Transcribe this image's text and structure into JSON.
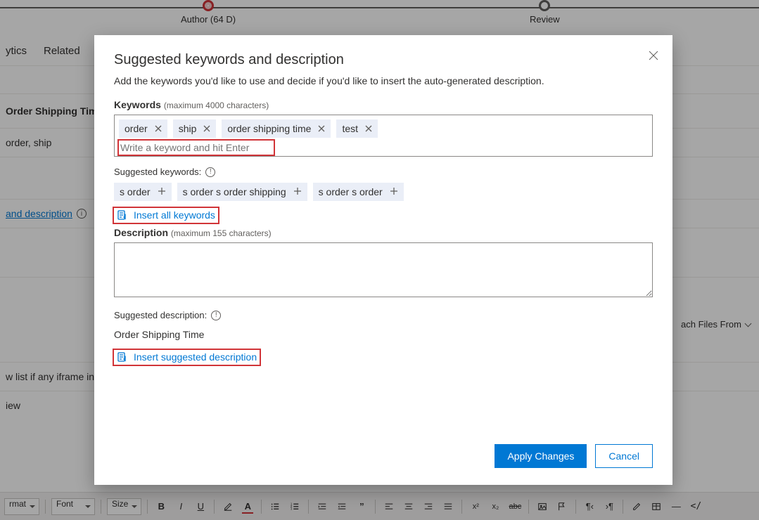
{
  "stepper": {
    "author": "Author  (64 D)",
    "review": "Review"
  },
  "tabs": {
    "analytics": "ytics",
    "related": "Related"
  },
  "bg": {
    "row1": "Order Shipping Time",
    "row2": "order, ship",
    "link": "and description",
    "iframe": "w list if any iframe in t",
    "view": "iew",
    "attach": "ach Files From"
  },
  "toolbar": {
    "format": "rmat",
    "font": "Font",
    "size": "Size"
  },
  "dialog": {
    "title": "Suggested keywords and description",
    "subtitle": "Add the keywords you'd like to use and decide if you'd like to insert the auto-generated description.",
    "keywords_label": "Keywords",
    "keywords_hint": "(maximum 4000 characters)",
    "kw_placeholder": "Write a keyword and hit Enter",
    "chips": [
      "order",
      "ship",
      "order shipping time",
      "test"
    ],
    "suggested_label": "Suggested keywords:",
    "suggested": [
      "s order",
      "s order s order shipping",
      "s order s order"
    ],
    "insert_all": "Insert all keywords",
    "description_label": "Description",
    "description_hint": "(maximum 155 characters)",
    "sugg_desc_label": "Suggested description:",
    "sugg_desc_text": "Order Shipping Time",
    "insert_desc": "Insert suggested description",
    "apply": "Apply Changes",
    "cancel": "Cancel"
  }
}
